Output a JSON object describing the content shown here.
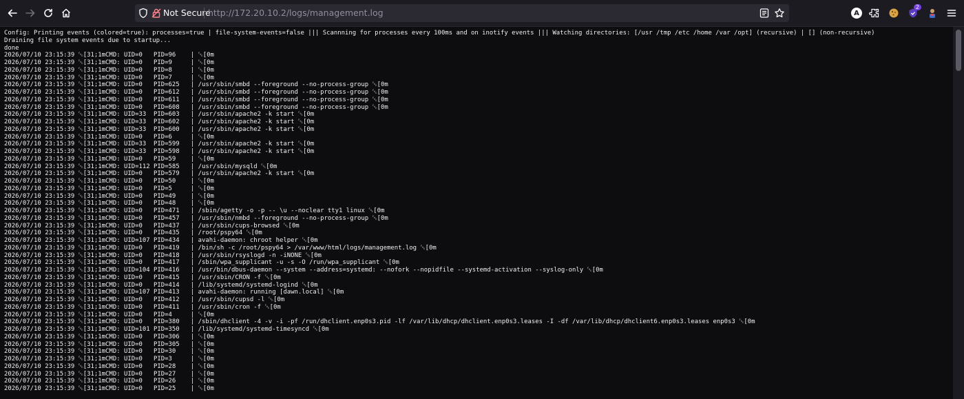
{
  "browser": {
    "security_label": "Not Secure",
    "url_prefix": "http://",
    "url_host": "172.20.10.2",
    "url_path": "/logs/management.log",
    "extensions": [
      "avatar-a-icon",
      "extensions-icon",
      "cookie-icon",
      "shield-extension-icon",
      "hacker-icon"
    ],
    "extension_badge": "2"
  },
  "log": {
    "header": [
      "Config: Printing events (colored=true): processes=true | file-system-events=false ||| Scannning for processes every 100ms and on inotify events ||| Watching directories: [/usr /tmp /etc /home /var /opt] (recursive) | [] (non-recursive)",
      "Draining file system events due to startup...",
      "done"
    ],
    "timestamp": "2026/07/10 23:15:39",
    "esc": "␛[31;1mCMD:",
    "entries": [
      {
        "uid": "0",
        "pid": "96",
        "cmd": ""
      },
      {
        "uid": "0",
        "pid": "9",
        "cmd": ""
      },
      {
        "uid": "0",
        "pid": "8",
        "cmd": ""
      },
      {
        "uid": "0",
        "pid": "7",
        "cmd": ""
      },
      {
        "uid": "0",
        "pid": "625",
        "cmd": "/usr/sbin/smbd --foreground --no-process-group "
      },
      {
        "uid": "0",
        "pid": "612",
        "cmd": "/usr/sbin/smbd --foreground --no-process-group "
      },
      {
        "uid": "0",
        "pid": "611",
        "cmd": "/usr/sbin/smbd --foreground --no-process-group "
      },
      {
        "uid": "0",
        "pid": "608",
        "cmd": "/usr/sbin/smbd --foreground --no-process-group "
      },
      {
        "uid": "33",
        "pid": "603",
        "cmd": "/usr/sbin/apache2 -k start "
      },
      {
        "uid": "33",
        "pid": "602",
        "cmd": "/usr/sbin/apache2 -k start "
      },
      {
        "uid": "33",
        "pid": "600",
        "cmd": "/usr/sbin/apache2 -k start "
      },
      {
        "uid": "0",
        "pid": "6",
        "cmd": ""
      },
      {
        "uid": "33",
        "pid": "599",
        "cmd": "/usr/sbin/apache2 -k start "
      },
      {
        "uid": "33",
        "pid": "598",
        "cmd": "/usr/sbin/apache2 -k start "
      },
      {
        "uid": "0",
        "pid": "59",
        "cmd": ""
      },
      {
        "uid": "112",
        "pid": "585",
        "cmd": "/usr/sbin/mysqld "
      },
      {
        "uid": "0",
        "pid": "579",
        "cmd": "/usr/sbin/apache2 -k start "
      },
      {
        "uid": "0",
        "pid": "50",
        "cmd": ""
      },
      {
        "uid": "0",
        "pid": "5",
        "cmd": ""
      },
      {
        "uid": "0",
        "pid": "49",
        "cmd": ""
      },
      {
        "uid": "0",
        "pid": "48",
        "cmd": ""
      },
      {
        "uid": "0",
        "pid": "471",
        "cmd": "/sbin/agetty -o -p -- \\u --noclear tty1 linux "
      },
      {
        "uid": "0",
        "pid": "457",
        "cmd": "/usr/sbin/nmbd --foreground --no-process-group "
      },
      {
        "uid": "0",
        "pid": "437",
        "cmd": "/usr/sbin/cups-browsed "
      },
      {
        "uid": "0",
        "pid": "435",
        "cmd": "/root/pspy64 "
      },
      {
        "uid": "107",
        "pid": "434",
        "cmd": "avahi-daemon: chroot helper "
      },
      {
        "uid": "0",
        "pid": "419",
        "cmd": "/bin/sh -c /root/pspy64 > /var/www/html/logs/management.log "
      },
      {
        "uid": "0",
        "pid": "418",
        "cmd": "/usr/sbin/rsyslogd -n -iNONE "
      },
      {
        "uid": "0",
        "pid": "417",
        "cmd": "/sbin/wpa_supplicant -u -s -O /run/wpa_supplicant "
      },
      {
        "uid": "104",
        "pid": "416",
        "cmd": "/usr/bin/dbus-daemon --system --address=systemd: --nofork --nopidfile --systemd-activation --syslog-only "
      },
      {
        "uid": "0",
        "pid": "415",
        "cmd": "/usr/sbin/CRON -f "
      },
      {
        "uid": "0",
        "pid": "414",
        "cmd": "/lib/systemd/systemd-logind "
      },
      {
        "uid": "107",
        "pid": "413",
        "cmd": "avahi-daemon: running [dawn.local] "
      },
      {
        "uid": "0",
        "pid": "412",
        "cmd": "/usr/sbin/cupsd -l "
      },
      {
        "uid": "0",
        "pid": "411",
        "cmd": "/usr/sbin/cron -f "
      },
      {
        "uid": "0",
        "pid": "4",
        "cmd": ""
      },
      {
        "uid": "0",
        "pid": "380",
        "cmd": "/sbin/dhclient -4 -v -i -pf /run/dhclient.enp0s3.pid -lf /var/lib/dhcp/dhclient.enp0s3.leases -I -df /var/lib/dhcp/dhclient6.enp0s3.leases enp0s3 "
      },
      {
        "uid": "101",
        "pid": "350",
        "cmd": "/lib/systemd/systemd-timesyncd "
      },
      {
        "uid": "0",
        "pid": "306",
        "cmd": ""
      },
      {
        "uid": "0",
        "pid": "305",
        "cmd": ""
      },
      {
        "uid": "0",
        "pid": "30",
        "cmd": ""
      },
      {
        "uid": "0",
        "pid": "3",
        "cmd": ""
      },
      {
        "uid": "0",
        "pid": "28",
        "cmd": ""
      },
      {
        "uid": "0",
        "pid": "27",
        "cmd": ""
      },
      {
        "uid": "0",
        "pid": "26",
        "cmd": ""
      },
      {
        "uid": "0",
        "pid": "25",
        "cmd": ""
      }
    ],
    "reset": "␛[0m"
  }
}
